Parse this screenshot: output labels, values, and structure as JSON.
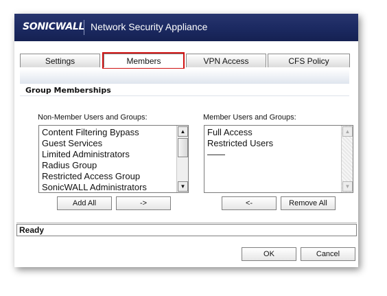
{
  "header": {
    "logo_text": "SONICWALL",
    "title": "Network Security Appliance",
    "background": "#1c2a62"
  },
  "tabs": [
    {
      "label": "Settings",
      "selected": false
    },
    {
      "label": "Members",
      "selected": true
    },
    {
      "label": "VPN Access",
      "selected": false
    },
    {
      "label": "CFS Policy",
      "selected": false
    }
  ],
  "highlight_color": "#d01010",
  "section": {
    "title": "Group Memberships"
  },
  "non_members": {
    "label": "Non-Member Users and Groups:",
    "items": [
      "Content Filtering Bypass",
      "Guest Services",
      "Limited Administrators",
      "Radius Group",
      "Restricted Access Group",
      "SonicWALL Administrators"
    ]
  },
  "members": {
    "label": "Member Users and Groups:",
    "items": [
      "Full Access",
      "Restricted Users",
      "——"
    ]
  },
  "buttons": {
    "add_all": "Add All",
    "add": "->",
    "remove": "<-",
    "remove_all": "Remove All",
    "ok": "OK",
    "cancel": "Cancel"
  },
  "status": {
    "text": "Ready"
  }
}
